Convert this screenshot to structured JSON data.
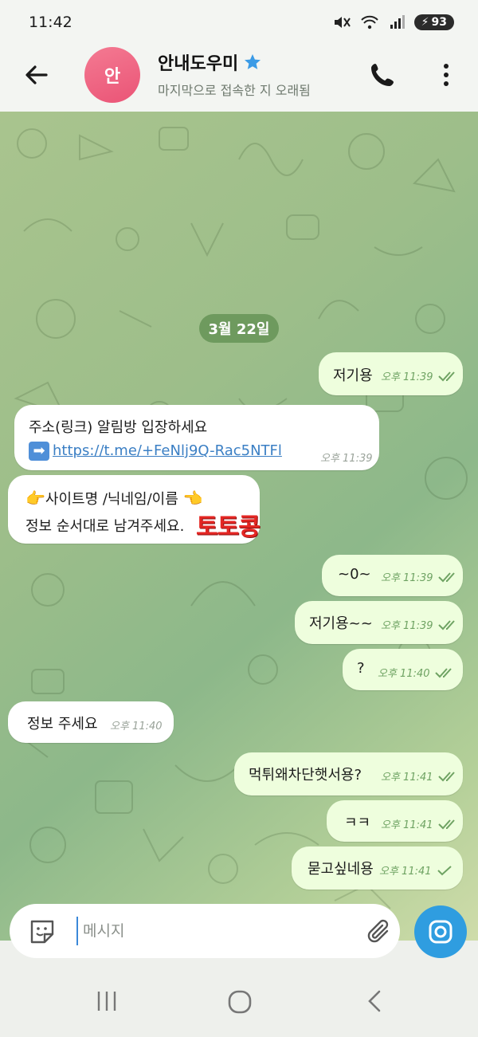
{
  "status_bar": {
    "time": "11:42",
    "battery": "93"
  },
  "header": {
    "avatar_text": "안",
    "title": "안내도우미",
    "subtitle": "마지막으로 접속한 지 오래됨",
    "colors": {
      "avatar": "#ea5476",
      "star": "#3b9be6"
    }
  },
  "chat": {
    "date": "3월 22일",
    "messages": [
      {
        "dir": "out",
        "text": "저기용",
        "time": "오후 11:39",
        "read": true
      },
      {
        "dir": "in",
        "line1": "주소(링크) 알림방 입장하세요",
        "arrow_icon": "right-arrow-emoji",
        "link": "https://t.me/+FeNlj9Q-Rac5NTFl",
        "time": "오후 11:39"
      },
      {
        "dir": "in",
        "line1_hand_left": "👉",
        "line1": "사이트명 /닉네임/이름",
        "line1_hand_right": "👈",
        "line2": "정보 순서대로 남겨주세요.",
        "watermark": "토토콩"
      },
      {
        "dir": "out",
        "text": "~0~",
        "time": "오후 11:39",
        "read": true
      },
      {
        "dir": "out",
        "text": "저기용~~",
        "time": "오후 11:39",
        "read": true
      },
      {
        "dir": "out",
        "text": "?",
        "time": "오후 11:40",
        "read": true
      },
      {
        "dir": "in",
        "text": "정보 주세요",
        "time": "오후 11:40"
      },
      {
        "dir": "out",
        "text": "먹튀왜차단햇서용?",
        "time": "오후 11:41",
        "read": true
      },
      {
        "dir": "out",
        "text": "ㅋㅋ",
        "time": "오후 11:41",
        "read": true
      },
      {
        "dir": "out",
        "text": "묻고싶네용",
        "time": "오후 11:41",
        "read": false
      }
    ]
  },
  "composer": {
    "placeholder": "메시지"
  },
  "colors": {
    "outgoing_bubble": "#eefedd",
    "incoming_bubble": "#ffffff",
    "send_button": "#2f9de0",
    "check": "#6fa363"
  }
}
